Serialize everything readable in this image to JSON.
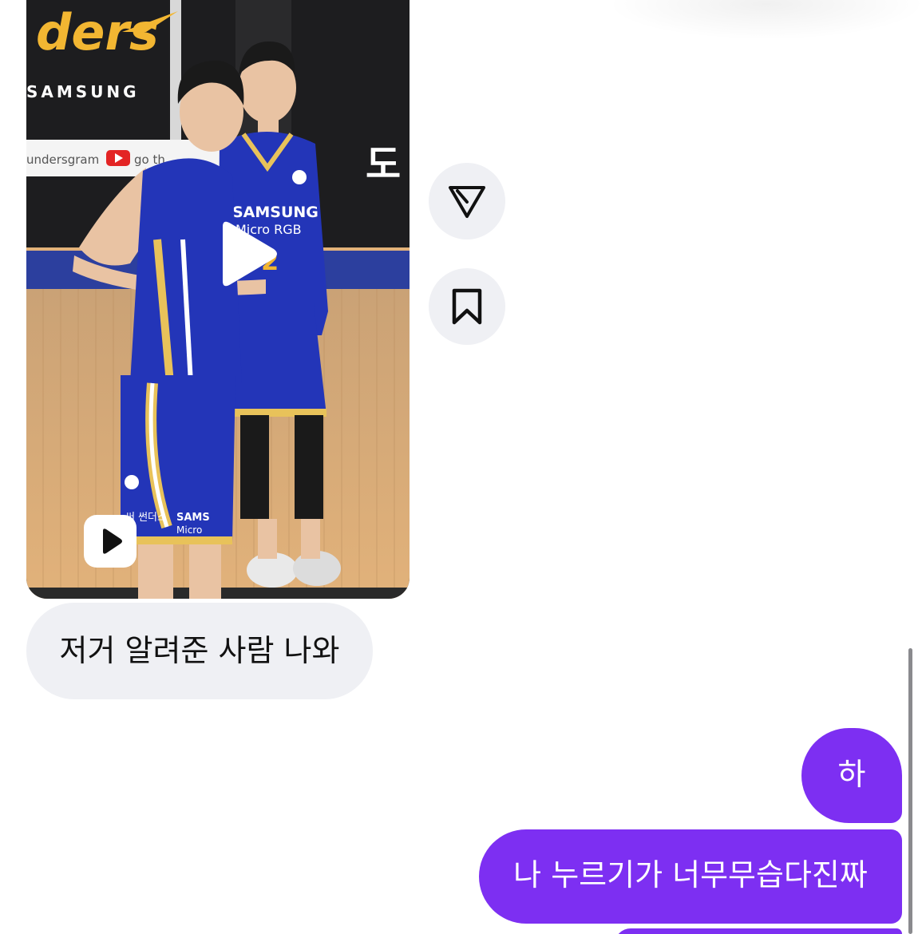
{
  "reel": {
    "backdrop_logo": "ders",
    "backdrop_sponsor": "SAMSUNG",
    "backdrop_handle": "undersgram",
    "backdrop_youtube": "go th",
    "backdrop_korean": "도",
    "jersey_sponsor": "SAMSUNG",
    "jersey_sponsor_sub": "Micro RGB",
    "jersey_number": "2",
    "left_jersey_text": "SAMS",
    "left_jersey_sub": "Micro",
    "left_jersey_korean": "써 썬더스"
  },
  "actions": {
    "share_icon": "paper-plane-icon",
    "save_icon": "bookmark-icon"
  },
  "messages": {
    "incoming": [
      {
        "text": "저거 알려준 사람 나와"
      }
    ],
    "outgoing": [
      {
        "text": "하"
      },
      {
        "text": "나 누르기가 너무무습다진짜"
      },
      {
        "text": ""
      }
    ]
  },
  "colors": {
    "outgoing_bubble": "#7d2ff2",
    "incoming_bubble": "#eff0f4",
    "action_button": "#eff0f4",
    "jersey_blue": "#2335b8",
    "jersey_trim": "#e8c25a",
    "court": "#d9a56b"
  }
}
